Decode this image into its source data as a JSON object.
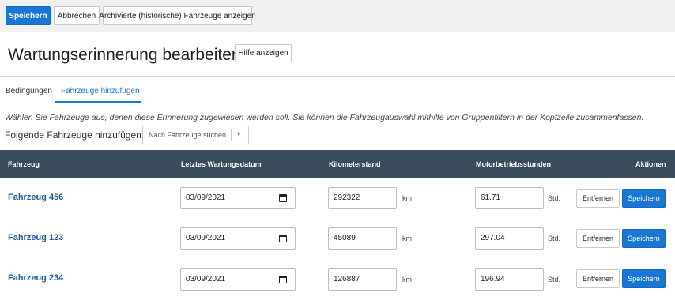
{
  "toolbar": {
    "save_label": "Speichern",
    "cancel_label": "Abbrechen",
    "archived_label": "Archivierte (historische) Fahrzeuge anzeigen"
  },
  "page": {
    "title": "Wartungserinnerung bearbeiten",
    "help_label": "Hilfe anzeigen"
  },
  "tabs": [
    {
      "label": "Bedingungen",
      "active": false
    },
    {
      "label": "Fahrzeuge hinzufügen",
      "active": true
    }
  ],
  "info_text": "Wählen Sie Fahrzeuge aus, denen diese Erinnerung zugewiesen werden soll. Sie können die Fahrzeugauswahl mithilfe von Gruppenfiltern in der Kopfzeile zusammenfassen.",
  "add_vehicles": {
    "label": "Folgende Fahrzeuge hinzufügen:",
    "search_placeholder": "Nach Fahrzeuge suchen"
  },
  "table": {
    "columns": [
      "Fahrzeug",
      "Letztes Wartungsdatum",
      "Kilometerstand",
      "Motorbetriebsstunden",
      "Aktionen"
    ],
    "km_unit": "km",
    "hours_unit": "Std.",
    "remove_label": "Entfernen",
    "save_label": "Speichern",
    "rows": [
      {
        "vehicle": "Fahrzeug 456",
        "date": "03/09/2021",
        "km": "292322",
        "hours": "61.71"
      },
      {
        "vehicle": "Fahrzeug 123",
        "date": "03/09/2021",
        "km": "45089",
        "hours": "297.04"
      },
      {
        "vehicle": "Fahrzeug 234",
        "date": "03/09/2021",
        "km": "126887",
        "hours": "196.94"
      }
    ]
  },
  "colors": {
    "primary": "#1976d2",
    "table_header": "#3a4b5c",
    "vehicle_link": "#1f5a96"
  }
}
